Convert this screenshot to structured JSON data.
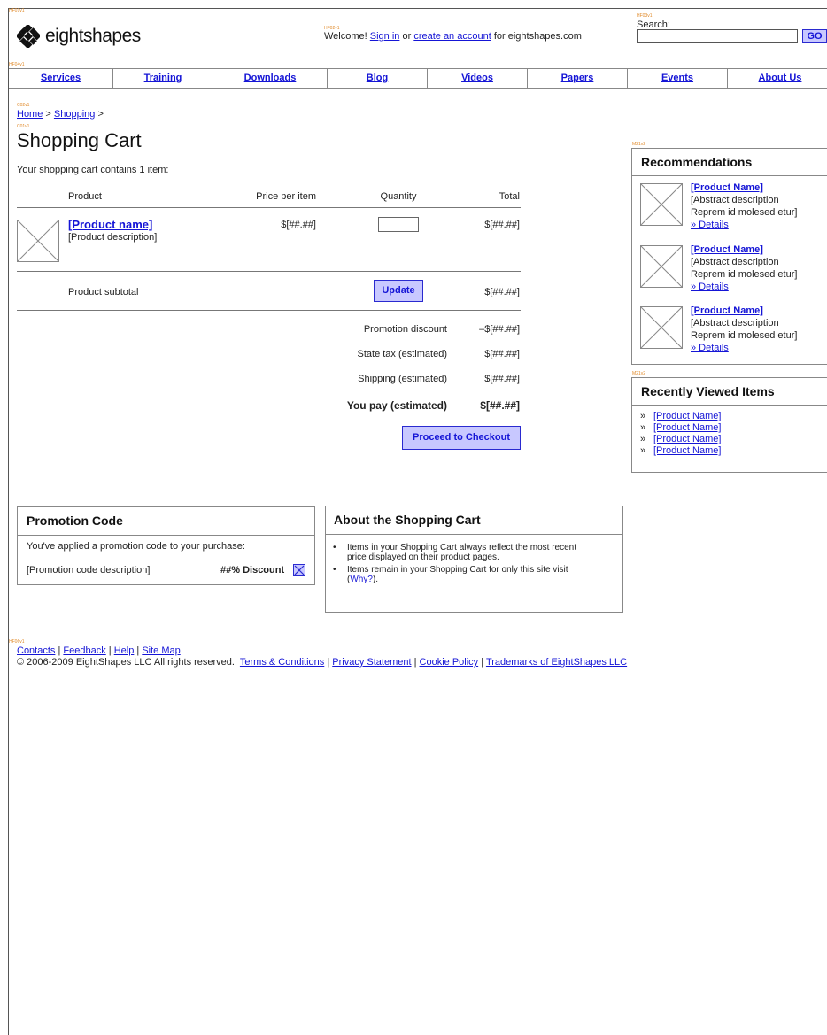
{
  "brand": {
    "name": "eightshapes"
  },
  "header": {
    "welcome_prefix": "Welcome!",
    "sign_in": "Sign in",
    "or": "or",
    "create_account": "create an account",
    "welcome_suffix": "for eightshapes.com",
    "search_label": "Search:",
    "search_value": "",
    "go_label": "GO"
  },
  "nav": [
    "Services",
    "Training",
    "Downloads",
    "Blog",
    "Videos",
    "Papers",
    "Events",
    "About Us"
  ],
  "breadcrumb": {
    "home": "Home",
    "sep": ">",
    "shopping": "Shopping"
  },
  "page_title": "Shopping Cart",
  "cart": {
    "intro": "Your shopping cart contains 1 item:",
    "columns": {
      "product": "Product",
      "price": "Price per item",
      "quantity": "Quantity",
      "total": "Total"
    },
    "item": {
      "name": "[Product name]",
      "description": "[Product description]",
      "price": "$[##.##]",
      "quantity": "",
      "total": "$[##.##]"
    },
    "subtotal_label": "Product subtotal",
    "update_label": "Update",
    "subtotal_value": "$[##.##]",
    "summary": [
      {
        "label": "Promotion discount",
        "value": "–$[##.##]"
      },
      {
        "label": "State tax (estimated)",
        "value": "$[##.##]"
      },
      {
        "label": "Shipping (estimated)",
        "value": "$[##.##]"
      }
    ],
    "you_pay_label": "You pay (estimated)",
    "you_pay_value": "$[##.##]",
    "checkout_label": "Proceed to Checkout"
  },
  "recommendations": {
    "title": "Recommendations",
    "items": [
      {
        "name": "[Product Name]",
        "desc1": "[Abstract description",
        "desc2": "Reprem id molesed etur]",
        "details": "» Details"
      },
      {
        "name": "[Product Name]",
        "desc1": "[Abstract description",
        "desc2": "Reprem id molesed etur]",
        "details": "» Details"
      },
      {
        "name": "[Product Name]",
        "desc1": "[Abstract description",
        "desc2": "Reprem id molesed etur]",
        "details": "» Details"
      }
    ]
  },
  "recently_viewed": {
    "title": "Recently Viewed Items",
    "items": [
      "[Product Name]",
      "[Product Name]",
      "[Product Name]",
      "[Product Name]"
    ]
  },
  "promotion": {
    "title": "Promotion Code",
    "text": "You've applied a promotion code to your purchase:",
    "code_desc": "[Promotion code description]",
    "discount": "##% Discount"
  },
  "about": {
    "title": "About the Shopping Cart",
    "bullet1_line1": "Items in your Shopping Cart always reflect the most recent",
    "bullet1_line2": "price displayed on their product pages.",
    "bullet2_line1": "Items remain in your Shopping Cart for only this site visit",
    "bullet2_open": "(",
    "bullet2_link": "Why?",
    "bullet2_close": ")."
  },
  "footer": {
    "links": [
      "Contacts",
      "Feedback",
      "Help",
      "Site Map"
    ],
    "copyright": "© 2006-2009 EightShapes LLC All rights reserved.",
    "legal_links": [
      "Terms & Conditions",
      "Privacy Statement",
      "Cookie Policy",
      "Trademarks of EightShapes LLC"
    ]
  },
  "tags": {
    "t1": "HF01v1",
    "t2": "HF02v1",
    "t3": "HF03v1",
    "t4": "HF04v1",
    "t5": "C02v1",
    "t6": "C01v1",
    "t7": "M21v2",
    "t8": "M21v2",
    "t9": "HF06v1"
  }
}
